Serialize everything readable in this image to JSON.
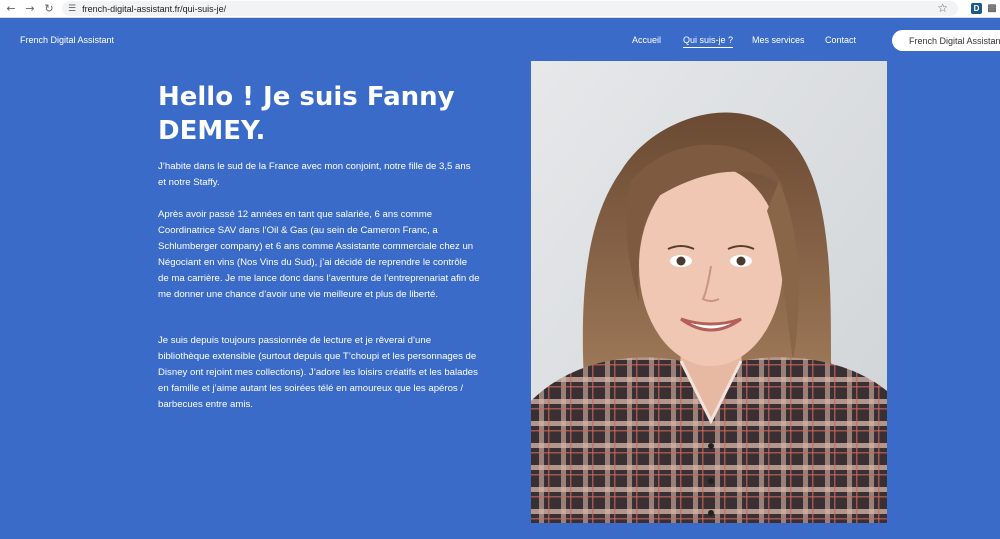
{
  "browser": {
    "url": "french-digital-assistant.fr/qui-suis-je/"
  },
  "header": {
    "brand": "French Digital Assistant",
    "menu": [
      {
        "label": "Accueil",
        "active": false
      },
      {
        "label": "Qui suis-je ?",
        "active": true
      },
      {
        "label": "Mes services",
        "active": false
      },
      {
        "label": "Contact",
        "active": false
      }
    ],
    "cta": "French Digital Assistant"
  },
  "main": {
    "title": "Hello ! Je suis Fanny DEMEY.",
    "paragraphs": [
      "J’habite dans le sud de la France avec mon conjoint, notre fille de 3,5 ans et notre Staffy.",
      "Après avoir passé 12 années en tant que salariée, 6 ans comme Coordinatrice SAV dans l’Oil & Gas (au sein de Cameron Franc, a Schlumberger company) et 6 ans comme Assistante commerciale chez un Négociant en vins (Nos Vins du Sud), j’ai décidé de reprendre le contrôle de ma carrière. Je me lance donc dans l’aventure de l’entreprenariat afin de me donner une chance d’avoir une vie meilleure et plus de liberté.",
      "Je suis depuis toujours passionnée de lecture et je rêverai d’une bibliothèque extensible (surtout depuis que T’choupi et les personnages de Disney ont rejoint mes collections). J’adore les loisirs créatifs et les balades en famille et j’aime autant les soirées télé en amoureux que les apéros / barbecues entre amis."
    ]
  },
  "colors": {
    "background": "#3b6bc9",
    "text": "#ffffff"
  }
}
